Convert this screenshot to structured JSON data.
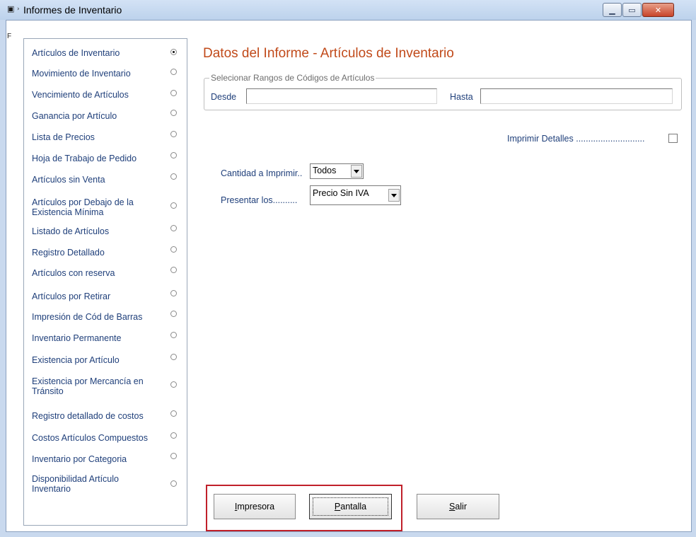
{
  "window": {
    "title": "Informes de Inventario",
    "form_label": "F"
  },
  "sidebar": {
    "items": [
      {
        "label": "Artículos de Inventario",
        "selected": true
      },
      {
        "label": "Movimiento de Inventario",
        "selected": false
      },
      {
        "label": "Vencimiento de Artículos",
        "selected": false
      },
      {
        "label": "Ganancia por Artículo",
        "selected": false
      },
      {
        "label": "Lista de Precios",
        "selected": false
      },
      {
        "label": "Hoja de Trabajo de Pedido",
        "selected": false
      },
      {
        "label": "Artículos sin Venta",
        "selected": false
      },
      {
        "label": "Artículos por Debajo de la Existencia Mínima",
        "selected": false
      },
      {
        "label": "Listado de Artículos",
        "selected": false
      },
      {
        "label": "Registro Detallado",
        "selected": false
      },
      {
        "label": "Artículos con reserva",
        "selected": false
      },
      {
        "label": "Artículos por Retirar",
        "selected": false
      },
      {
        "label": "Impresión de Cód de Barras",
        "selected": false
      },
      {
        "label": "Inventario Permanente",
        "selected": false
      },
      {
        "label": "Existencia por Artículo",
        "selected": false
      },
      {
        "label": "Existencia por Mercancía en Tránsito",
        "selected": false
      },
      {
        "label": "Registro detallado de costos",
        "selected": false
      },
      {
        "label": "Costos Artículos Compuestos",
        "selected": false
      },
      {
        "label": "Inventario por Categoria",
        "selected": false
      },
      {
        "label": "Disponibilidad Artículo Inventario",
        "selected": false
      }
    ]
  },
  "main": {
    "title": "Datos del Informe - Artículos de Inventario",
    "range_group": {
      "caption": "Selecionar Rangos de Códigos de Artículos",
      "desde_label": "Desde",
      "desde_value": "",
      "hasta_label": "Hasta",
      "hasta_value": ""
    },
    "print_details_label": "Imprimir Detalles ............................",
    "print_details_checked": false,
    "quantity_label": "Cantidad a Imprimir..",
    "quantity_value": "Todos",
    "present_label": "Presentar los..........",
    "present_value": "Precio Sin IVA"
  },
  "buttons": {
    "printer": {
      "accel": "I",
      "rest": "mpresora"
    },
    "screen": {
      "accel": "P",
      "rest": "antalla"
    },
    "exit": {
      "accel": "S",
      "rest": "alir"
    }
  },
  "colors": {
    "title_accent": "#c14a1a",
    "label_text": "#1f3f7a",
    "highlight_box": "#c0202a"
  }
}
